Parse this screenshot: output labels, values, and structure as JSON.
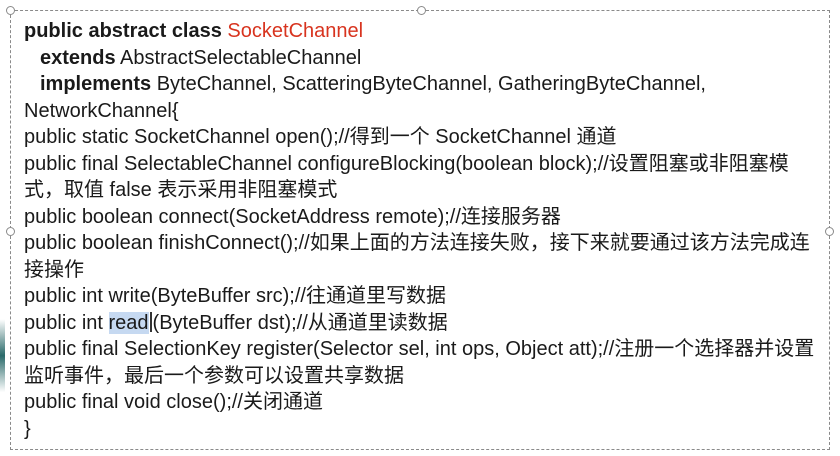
{
  "code": {
    "kw_public_abstract_class": "public abstract class ",
    "class_name": "SocketChannel",
    "kw_extends": "extends",
    "extends_target": " AbstractSelectableChannel",
    "kw_implements": "implements",
    "implements_list": " ByteChannel, ScatteringByteChannel, GatheringByteChannel,",
    "implements_cont": "NetworkChannel{",
    "m_open": "public static SocketChannel open();//得到一个 SocketChannel 通道",
    "m_configure": "public final SelectableChannel configureBlocking(boolean block);//设置阻塞或非阻塞模式，取值 false 表示采用非阻塞模式",
    "m_connect": "public boolean connect(SocketAddress remote);//连接服务器",
    "m_finish": "public boolean finishConnect();//如果上面的方法连接失败，接下来就要通过该方法完成连接操作",
    "m_write": "public int write(ByteBuffer src);//往通道里写数据",
    "m_read_pre": "public int ",
    "m_read_hl": "read",
    "m_read_post": "(ByteBuffer dst);//从通道里读数据",
    "m_register": "public final SelectionKey register(Selector sel, int ops, Object att);//注册一个选择器并设置监听事件，最后一个参数可以设置共享数据",
    "m_close": "public final void close();//关闭通道",
    "closing_brace": "}"
  }
}
